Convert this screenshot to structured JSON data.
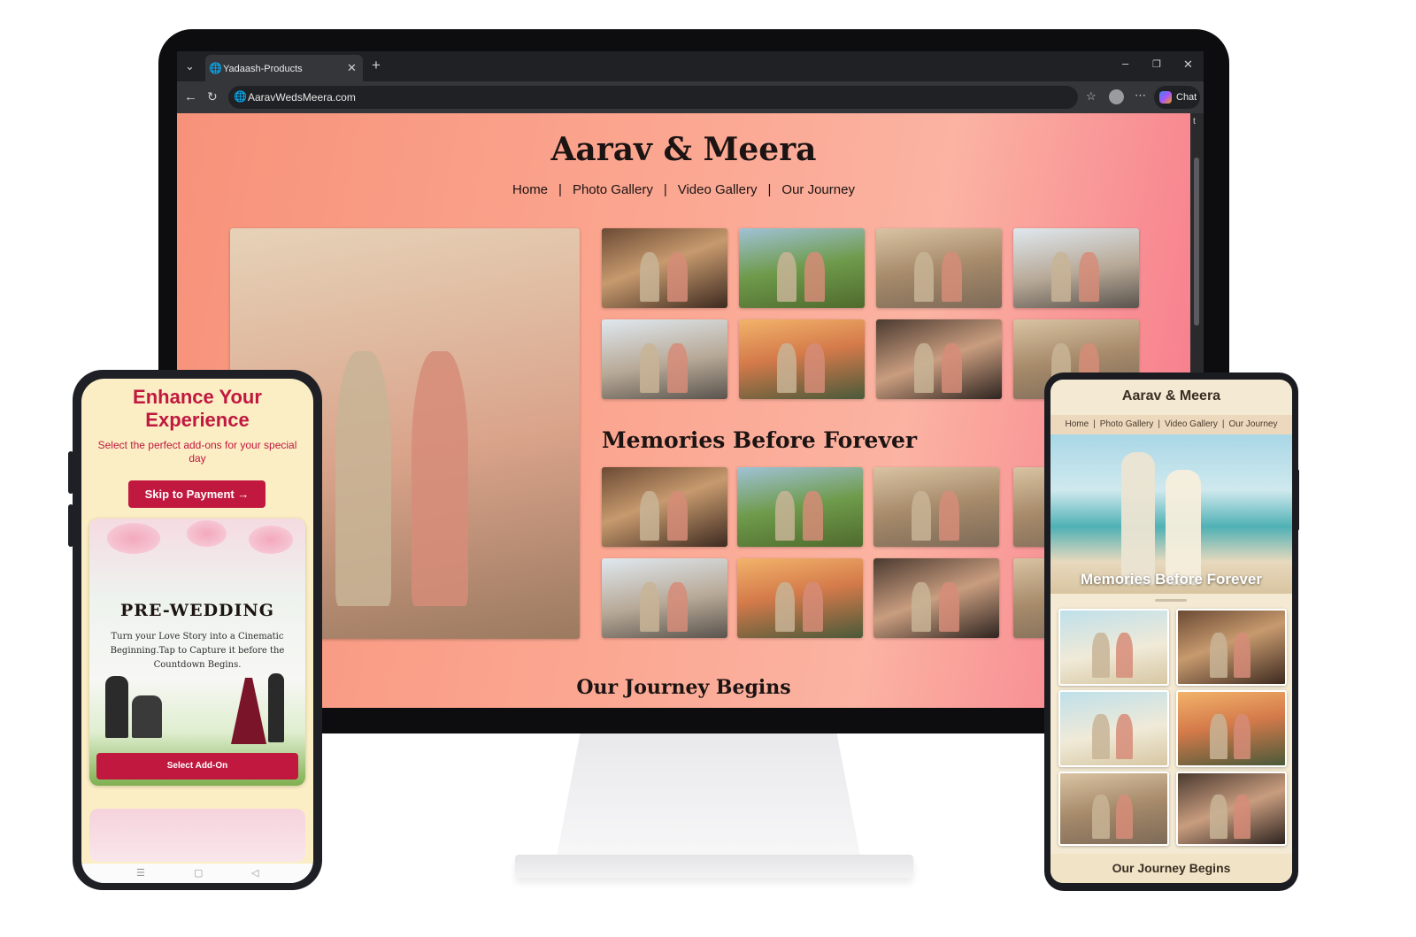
{
  "browser": {
    "tab_title": "Yadaash-Products",
    "url": "AaravWedsMeera.com",
    "chat_label": "Chat",
    "side_tab_char": "t"
  },
  "website": {
    "title": "Aarav & Meera",
    "nav": [
      "Home",
      "Photo Gallery",
      "Video Gallery",
      "Our Journey"
    ],
    "section_memories": "Memories Before Forever",
    "section_journey": "Our Journey Begins"
  },
  "phone": {
    "heading": "Enhance Your Experience",
    "subtitle": "Select the perfect add-ons for your special day",
    "skip_button": "Skip to Payment →",
    "card_title": "PRE-WEDDING",
    "card_text": "Turn your Love Story into a Cinematic Beginning.Tap to Capture it before the Countdown Begins.",
    "addon_button": "Select Add-On",
    "nav_icons": [
      "☰",
      "▢",
      "◁"
    ]
  },
  "tablet": {
    "title": "Aarav & Meera",
    "nav": [
      "Home",
      "Photo Gallery",
      "Video Gallery",
      "Our Journey"
    ],
    "hero_caption": "Memories Before Forever",
    "footer": "Our Journey Begins"
  },
  "colors": {
    "brand_red": "#c0183f",
    "page_gradient_start": "#f7927a",
    "page_gradient_end": "#f6768a",
    "cream": "#fbeec4"
  },
  "icons": [
    "globe-icon",
    "close-icon",
    "plus-icon",
    "back-icon",
    "reload-icon",
    "star-icon",
    "profile-icon",
    "more-icon",
    "copilot-icon",
    "minimize-icon",
    "restore-icon",
    "window-close-icon",
    "dropdown-icon"
  ]
}
